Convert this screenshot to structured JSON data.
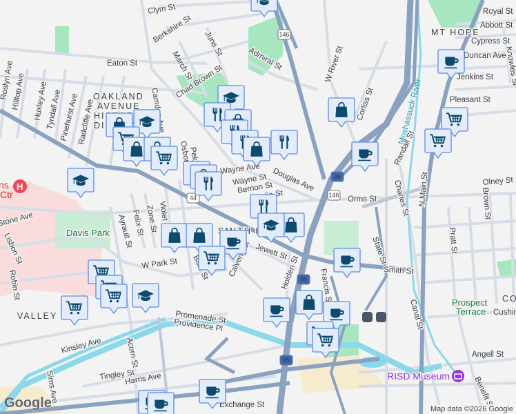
{
  "map": {
    "neighborhoods": [
      "OAKLAND",
      "AVENUE",
      "HISTORIC",
      "DISTRICT",
      "MT HOPE",
      "SMITH HILL",
      "VALLEY",
      "CO"
    ],
    "parks": [
      "Davis Park",
      "Prospect",
      "Terrace"
    ],
    "river": "Moshassuck River",
    "poi": "RISD Museum",
    "hospital_label": [
      "ns",
      "Ctr"
    ],
    "streets": [
      "Eaton St",
      "Chad Brown St",
      "Admiral St",
      "Berkshire St",
      "June St",
      "March St",
      "Clym St",
      "Huxley Ave",
      "Tyndall Ave",
      "Pinehurst Ave",
      "Radcliffe Ave",
      "Hilltop Ave",
      "Roslyn Ave",
      "W River St",
      "Corliss St",
      "Douglas Ave",
      "Wayne St",
      "Bernon St",
      "Lydia St",
      "Orms St",
      "Randall St",
      "Charles St",
      "N Main St",
      "Olney St",
      "Royal St",
      "Abbott St",
      "Cypress St",
      "Duncan Ave",
      "Jenkins St",
      "Pleasant St",
      "Knowles St",
      "Smith St",
      "Jewett St",
      "W Park St",
      "Calverly St",
      "Holden St",
      "State St",
      "Francis St",
      "Canal St",
      "Angell St",
      "Benefit St",
      "Promenade St",
      "Providence Pl",
      "Kinsley Ave",
      "Acorn St",
      "Tingley St",
      "Harris Ave",
      "Sims Ave",
      "Robin St",
      "Lisbon St",
      "Ayrault St",
      "Felix St",
      "Zone St",
      "Violet St",
      "Bath St",
      "Exchange St",
      "Pratt St",
      "Brown St",
      "Cushing",
      "Stone Ave",
      "Osborn St",
      "Camden Ave",
      "Pekin St",
      "Wayne Ave",
      "Lydia St"
    ],
    "shields": [
      "146",
      "146",
      "44",
      "95",
      "95",
      "95"
    ],
    "attribution": "Map data ©2026 Google",
    "logo": "Google"
  },
  "marker_types": [
    "cafe",
    "shopping",
    "restaurant",
    "school",
    "grocery"
  ],
  "colors": {
    "marker_fill": "#e3ecfb",
    "marker_border": "#5b8be0",
    "marker_icon": "#0d4a6e",
    "highway": "#8aa2c0",
    "road": "#d5dde6",
    "water": "#8ad8ea",
    "park": "#a8e6c0"
  }
}
